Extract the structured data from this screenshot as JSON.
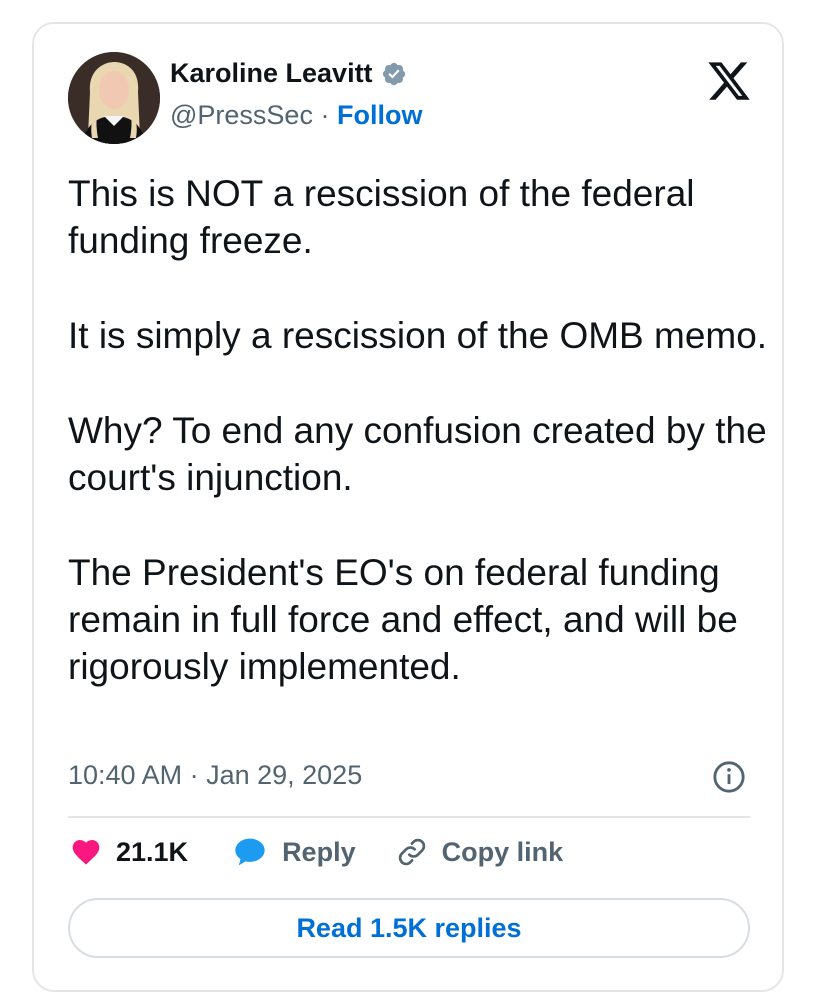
{
  "author": {
    "name": "Karoline Leavitt",
    "handle": "@PressSec",
    "separator": "·",
    "follow_label": "Follow"
  },
  "tweet": {
    "paragraphs": [
      "This is NOT a rescission of the federal funding freeze.",
      "It is simply a rescission of the OMB memo.",
      "Why? To end any confusion created by the court's injunction.",
      "The President's EO's on federal funding remain in full force and effect, and will be rigorously implemented."
    ],
    "timestamp": "10:40 AM · Jan 29, 2025"
  },
  "actions": {
    "likes": "21.1K",
    "reply_label": "Reply",
    "copy_link_label": "Copy link"
  },
  "read_replies_label": "Read 1.5K replies",
  "colors": {
    "link_blue": "#006fd6",
    "heart_pink": "#f91880",
    "reply_blue": "#1d9bf0",
    "verified_gray": "#829aab",
    "text": "#0f1419",
    "muted": "#536471"
  },
  "icons": {
    "verified": "verified-badge-icon",
    "logo": "x-logo-icon",
    "info": "info-icon",
    "like": "heart-icon",
    "reply": "speech-bubble-icon",
    "copy_link": "link-icon"
  }
}
